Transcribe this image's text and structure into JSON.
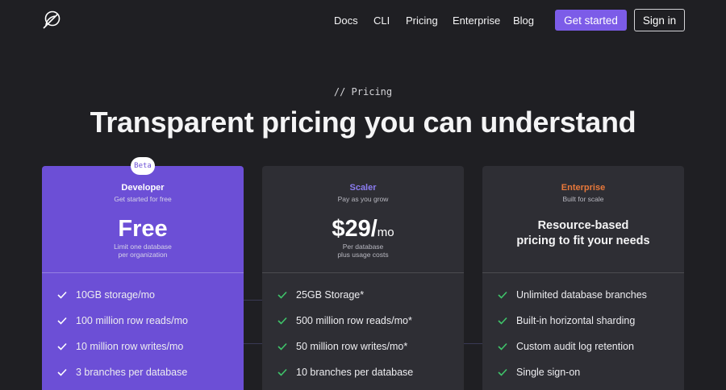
{
  "nav": {
    "logo_icon": "feather-circle-icon",
    "links": [
      "Docs",
      "CLI",
      "Pricing",
      "Enterprise",
      "Blog"
    ],
    "get_started": "Get started",
    "sign_in": "Sign in"
  },
  "hero": {
    "eyebrow": "// Pricing",
    "title": "Transparent pricing you can understand"
  },
  "colors": {
    "background": "#1f1f23",
    "accent": "#7c5ce8",
    "developer_card": "#6c4fd6",
    "card": "#2e2e34",
    "scaler_tier": "#8b7cf0",
    "enterprise_tier": "#e8783a",
    "check_dev": "#ffffff",
    "check_green": "#3fc46a"
  },
  "plans": {
    "developer": {
      "badge": "Beta",
      "tier": "Developer",
      "subtitle": "Get started for free",
      "price": "Free",
      "note_1": "Limit one database",
      "note_2": "per organization",
      "features": [
        "10GB storage/mo",
        "100 million row reads/mo",
        "10 million row writes/mo",
        "3 branches per database"
      ]
    },
    "scaler": {
      "tier": "Scaler",
      "subtitle": "Pay as you grow",
      "price": "$29/",
      "price_unit": "mo",
      "note_1": "Per database",
      "note_2": "plus usage costs",
      "features": [
        "25GB Storage*",
        "500 million row reads/mo*",
        "50 million row writes/mo*",
        "10 branches per database"
      ]
    },
    "enterprise": {
      "tier": "Enterprise",
      "subtitle": "Built for scale",
      "title_1": "Resource-based",
      "title_2": "pricing to fit your needs",
      "features": [
        "Unlimited database branches",
        "Built-in horizontal sharding",
        "Custom audit log retention",
        "Single sign-on"
      ]
    }
  }
}
